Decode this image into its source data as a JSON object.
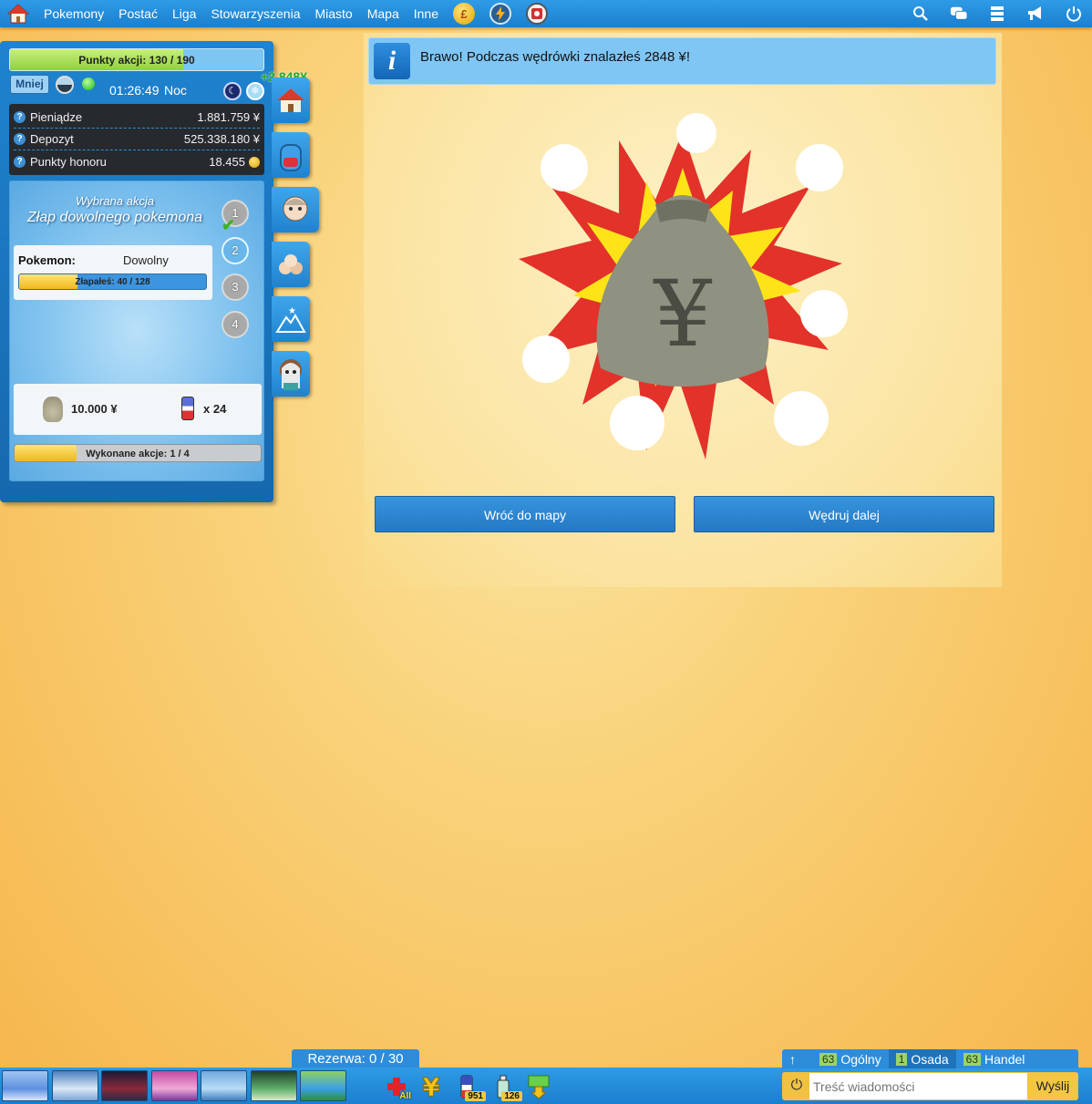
{
  "nav": {
    "items": [
      "Pokemony",
      "Postać",
      "Liga",
      "Stowarzyszenia",
      "Miasto",
      "Mapa",
      "Inne"
    ],
    "coin_symbol": "£"
  },
  "action_points": {
    "label": "Punkty akcji: 130 / 190",
    "current": 130,
    "max": 190
  },
  "toggle_label": "Mniej",
  "clock": "01:26:49",
  "daytime": "Noc",
  "stats": [
    {
      "label": "Pieniądze",
      "value": "1.881.759 ¥"
    },
    {
      "label": "Depozyt",
      "value": "525.338.180 ¥"
    },
    {
      "label": "Punkty honoru",
      "value": "18.455"
    }
  ],
  "money_gain": "+2.848¥",
  "action": {
    "label": "Wybrana akcja",
    "name": "Złap dowolnego pokemona",
    "steps": [
      "1",
      "2",
      "3",
      "4"
    ],
    "pokemon_label": "Pokemon:",
    "pokemon_value": "Dowolny",
    "progress_text": "Złapałeś: 40 / 128",
    "progress_current": 40,
    "progress_max": 128,
    "reward_money": "10.000 ¥",
    "reward_items": "x 24",
    "done_text": "Wykonane akcje: 1 / 4",
    "done_current": 1,
    "done_max": 4
  },
  "info": {
    "icon": "i",
    "message": "Brawo! Podczas wędrówki znalazłeś 2848 ¥!"
  },
  "buttons": {
    "back": "Wróć do mapy",
    "continue": "Wędruj dalej"
  },
  "bottom": {
    "reserve": "Rezerwa: 0 / 30",
    "tool_all": "All",
    "badge_balls": "951",
    "badge_potions": "126"
  },
  "chat": {
    "up_arrow": "↑",
    "tabs": [
      {
        "count": "63",
        "label": "Ogólny"
      },
      {
        "count": "1",
        "label": "Osada"
      },
      {
        "count": "63",
        "label": "Handel"
      }
    ],
    "placeholder": "Treść wiadomości",
    "send": "Wyślij"
  },
  "colors": {
    "accent": "#1f83cf",
    "bar_fill": "#8fd13e",
    "progress_fill": "#f0b81a",
    "button": "#2579c3"
  }
}
